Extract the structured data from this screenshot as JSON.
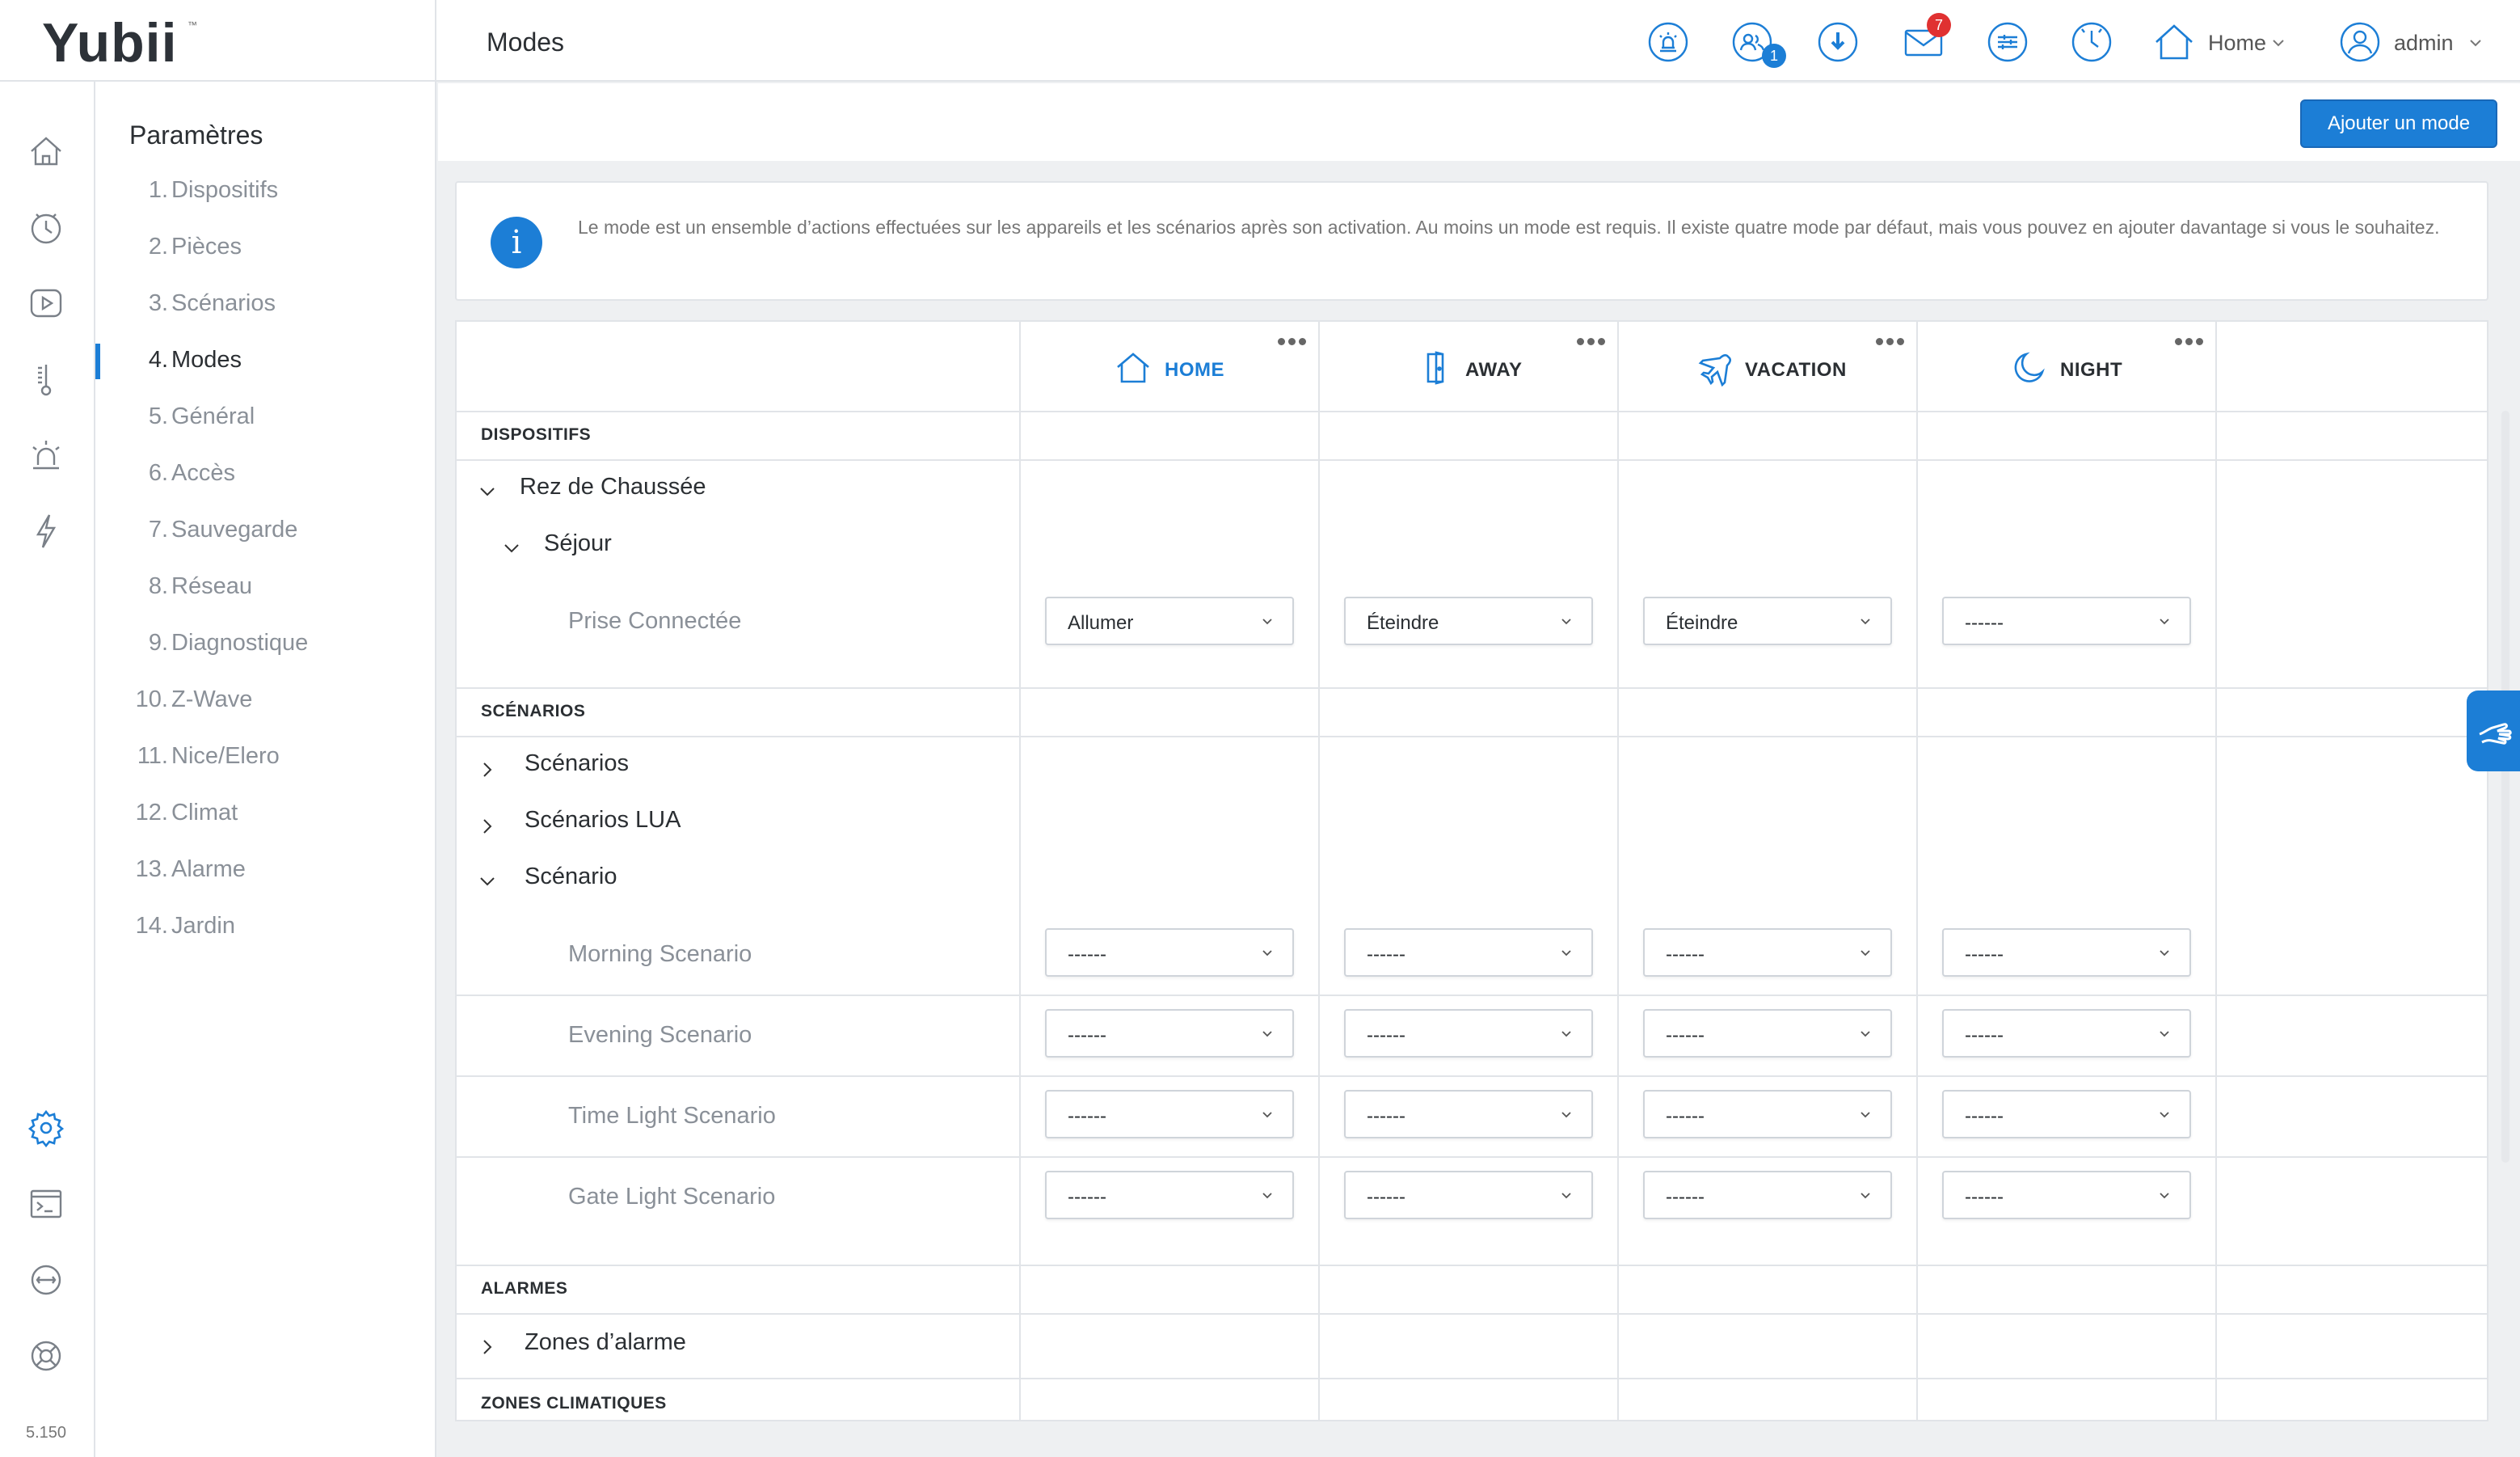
{
  "app": {
    "logo": "Yubii",
    "logo_tm": "™",
    "page_title": "Modes",
    "version": "5.150"
  },
  "topbar": {
    "icons": [
      "alarm-icon",
      "users-icon",
      "download-icon",
      "mail-icon",
      "scenes-icon",
      "clock-icon",
      "home-icon"
    ],
    "users_badge": "1",
    "mail_badge": "7",
    "home_label": "Home",
    "user_label": "admin"
  },
  "rail": {
    "icons": [
      "home-icon",
      "clock-icon",
      "play-icon",
      "thermometer-icon",
      "alarm-icon",
      "energy-icon",
      "settings-icon",
      "terminal-icon",
      "network-icon",
      "support-icon"
    ],
    "active": "settings-icon"
  },
  "settings_nav": {
    "title": "Paramètres",
    "items": [
      {
        "num": "1.",
        "label": "Dispositifs"
      },
      {
        "num": "2.",
        "label": "Pièces"
      },
      {
        "num": "3.",
        "label": "Scénarios"
      },
      {
        "num": "4.",
        "label": "Modes"
      },
      {
        "num": "5.",
        "label": "Général"
      },
      {
        "num": "6.",
        "label": "Accès"
      },
      {
        "num": "7.",
        "label": "Sauvegarde"
      },
      {
        "num": "8.",
        "label": "Réseau"
      },
      {
        "num": "9.",
        "label": "Diagnostique"
      },
      {
        "num": "10.",
        "label": "Z-Wave"
      },
      {
        "num": "11.",
        "label": "Nice/Elero"
      },
      {
        "num": "12.",
        "label": "Climat"
      },
      {
        "num": "13.",
        "label": "Alarme"
      },
      {
        "num": "14.",
        "label": "Jardin"
      }
    ],
    "active_index": 3
  },
  "actions": {
    "add_mode": "Ajouter un mode"
  },
  "info": {
    "text": "Le mode est un ensemble d’actions effectuées sur les appareils et les scénarios après son activation. Au moins un mode est requis. Il existe quatre mode par défaut, mais vous pouvez en ajouter davantage si vous le souhaitez."
  },
  "modes": [
    {
      "label": "HOME",
      "icon": "home-icon",
      "active": true
    },
    {
      "label": "AWAY",
      "icon": "door-icon",
      "active": false
    },
    {
      "label": "VACATION",
      "icon": "plane-icon",
      "active": false
    },
    {
      "label": "NIGHT",
      "icon": "moon-icon",
      "active": false
    }
  ],
  "sections": {
    "devices": "DISPOSITIFS",
    "scenarios": "SCÉNARIOS",
    "alarms": "ALARMES",
    "climate": "ZONES CLIMATIQUES"
  },
  "tree": {
    "floor": "Rez de Chaussée",
    "room": "Séjour",
    "device": "Prise Connectée",
    "scen_group1": "Scénarios",
    "scen_group2": "Scénarios LUA",
    "scen_group3": "Scénario",
    "alarm_zones": "Zones d’alarme"
  },
  "rows": [
    {
      "label": "Prise Connectée",
      "values": [
        "Allumer",
        "Éteindre",
        "Éteindre",
        "------"
      ]
    },
    {
      "label": "Morning Scenario",
      "values": [
        "------",
        "------",
        "------",
        "------"
      ]
    },
    {
      "label": "Evening Scenario",
      "values": [
        "------",
        "------",
        "------",
        "------"
      ]
    },
    {
      "label": "Time Light Scenario",
      "values": [
        "------",
        "------",
        "------",
        "------"
      ]
    },
    {
      "label": "Gate Light Scenario",
      "values": [
        "------",
        "------",
        "------",
        "------"
      ]
    }
  ],
  "colors": {
    "accent": "#1c7ed6",
    "badge_red": "#e03131",
    "text": "#2b2f33",
    "muted": "#8a9098"
  }
}
